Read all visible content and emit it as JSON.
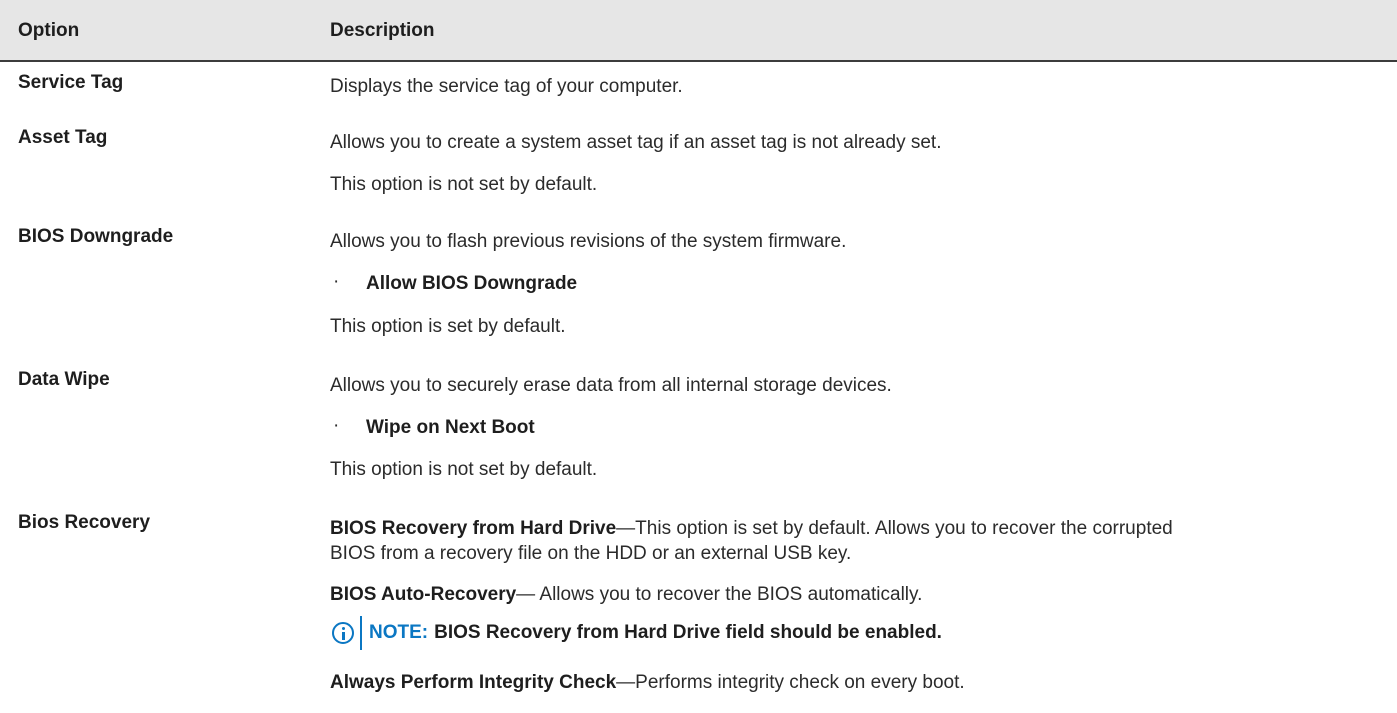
{
  "header": {
    "option": "Option",
    "description": "Description"
  },
  "rows": {
    "service_tag": {
      "option": "Service Tag",
      "desc": "Displays the service tag of your computer."
    },
    "asset_tag": {
      "option": "Asset Tag",
      "desc": "Allows you to create a system asset tag if an asset tag is not already set.",
      "default": "This option is not set by default."
    },
    "bios_downgrade": {
      "option": "BIOS Downgrade",
      "desc": "Allows you to flash previous revisions of the system firmware.",
      "bullet": "Allow BIOS Downgrade",
      "bullet_symbol": "·",
      "default": "This option is set by default."
    },
    "data_wipe": {
      "option": "Data Wipe",
      "desc": "Allows you to securely erase data from all internal storage devices.",
      "bullet": "Wipe on Next Boot",
      "bullet_symbol": "·",
      "default": "This option is not set by default."
    },
    "bios_recovery": {
      "option": "Bios Recovery",
      "item1_bold": "BIOS Recovery from Hard Drive",
      "item1_line1": "—This option is set by default. Allows you to recover the corrupted",
      "item1_line2": "BIOS from a recovery file on the HDD or an external USB key.",
      "item2_bold": "BIOS Auto-Recovery",
      "item2_text": "— Allows you to recover the BIOS automatically.",
      "note_label": "NOTE:",
      "note_text": "BIOS Recovery from Hard Drive field should be enabled.",
      "item3_bold": "Always Perform Integrity Check",
      "item3_text": "—Performs integrity check on every boot."
    }
  },
  "colors": {
    "header_bg": "#e6e6e6",
    "note_accent": "#0b77c3"
  },
  "icons": {
    "note": "info-circle-icon"
  }
}
